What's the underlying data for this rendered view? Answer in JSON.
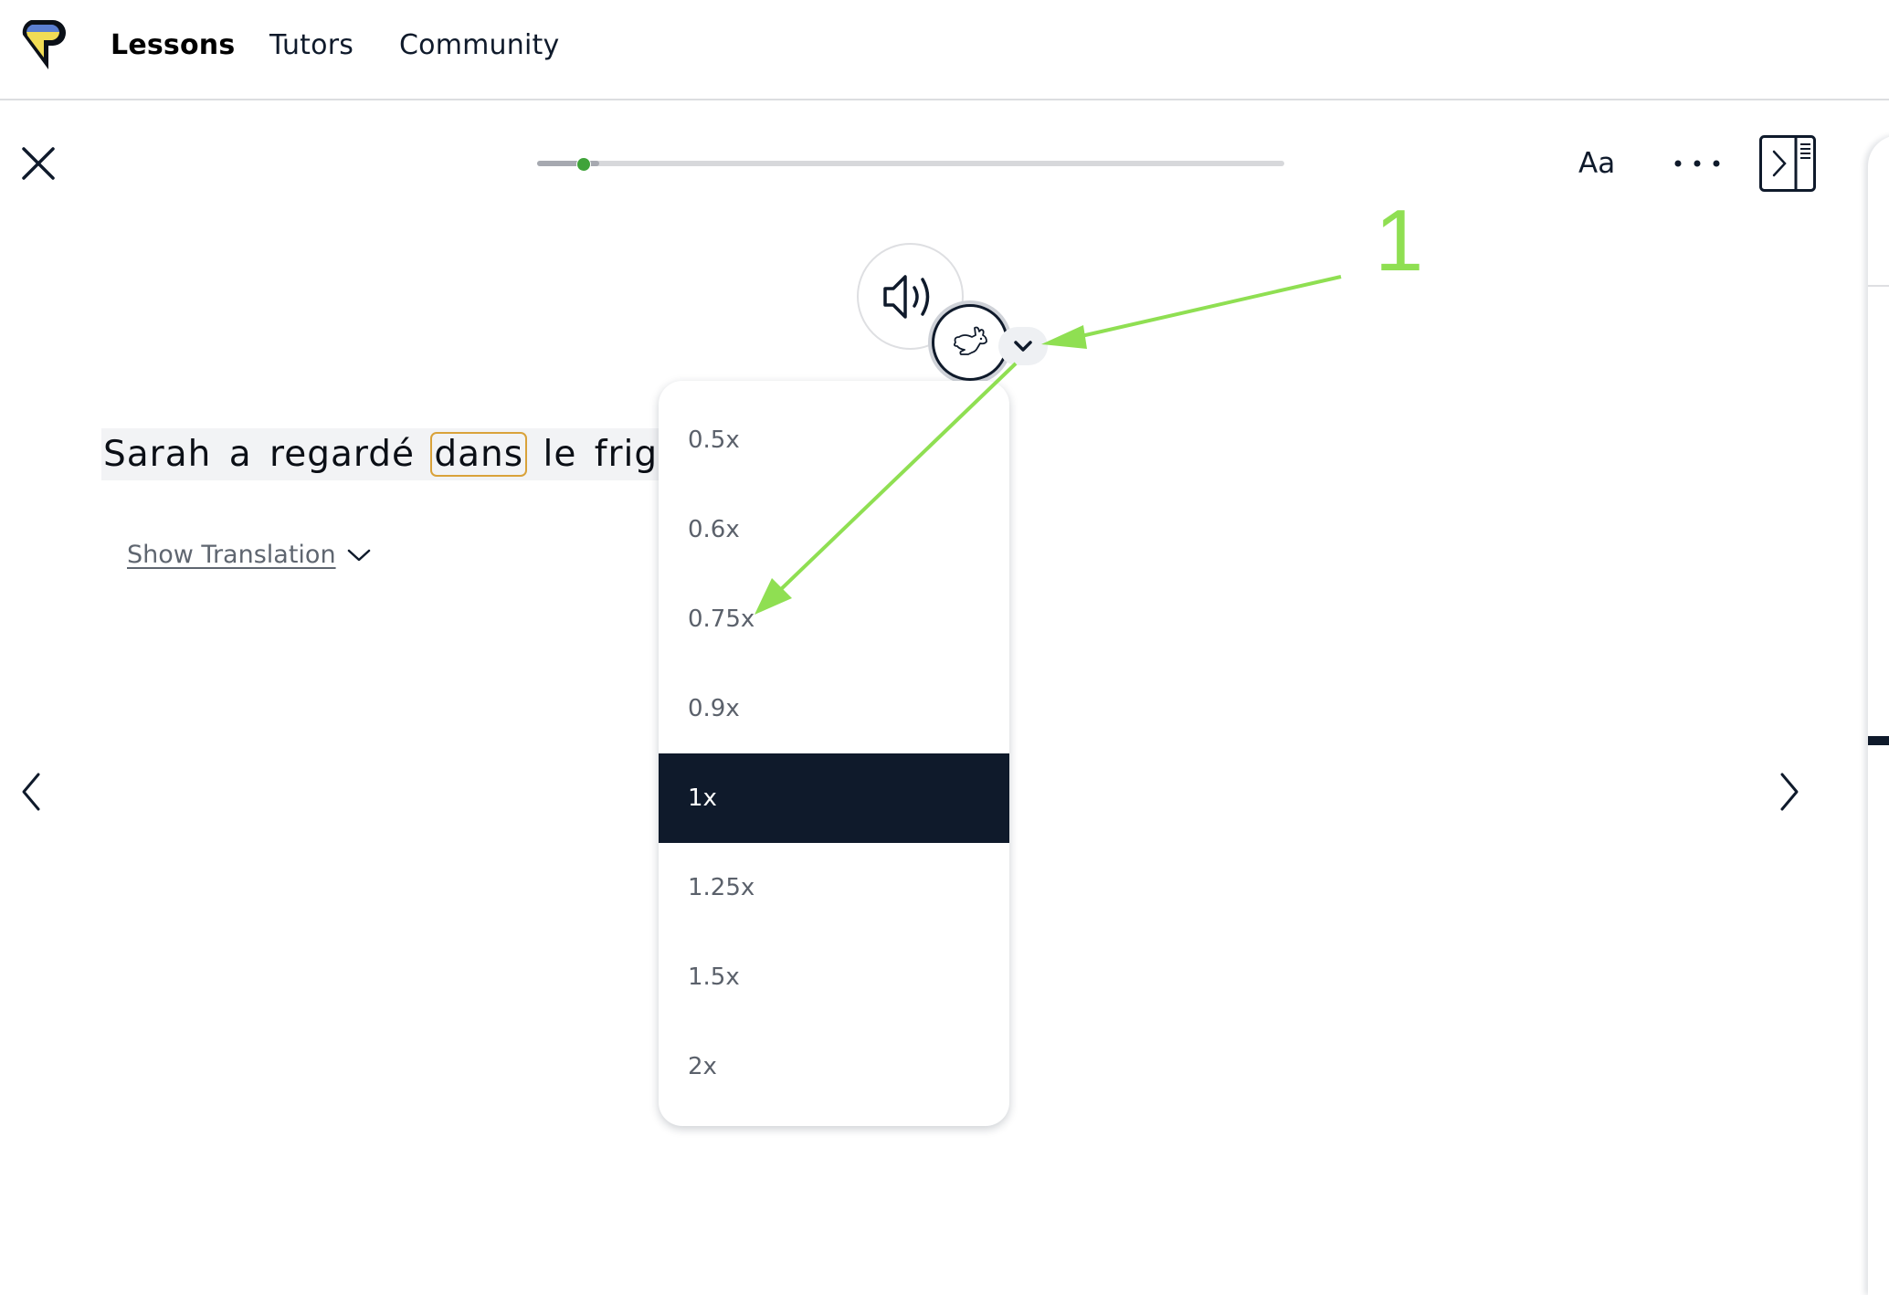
{
  "header": {
    "logo_icon": "speech-bubble-logo",
    "nav": [
      {
        "label": "Lessons",
        "active": true
      },
      {
        "label": "Tutors",
        "active": false
      },
      {
        "label": "Community",
        "active": false
      }
    ]
  },
  "toolbar": {
    "close_icon": "close-icon",
    "progress": {
      "fraction": 0.062,
      "fill_fraction": 0.083
    },
    "font_size_label": "Aa",
    "more_icon": "ellipsis-icon",
    "panel_toggle_icon": "sidebar-toggle-icon"
  },
  "audio": {
    "speaker_icon": "speaker-icon",
    "speed_icon": "rabbit-icon",
    "speed_dropdown_icon": "chevron-down-icon"
  },
  "lesson": {
    "sentence_words": [
      "Sarah",
      "a",
      "regardé",
      "dans",
      "le",
      "frigo."
    ],
    "highlighted_word_index": 3,
    "show_translation_label": "Show Translation"
  },
  "speed_menu": {
    "options": [
      "0.5x",
      "0.6x",
      "0.75x",
      "0.9x",
      "1x",
      "1.25x",
      "1.5x",
      "2x"
    ],
    "selected": "1x"
  },
  "annotation": {
    "label": "1",
    "color": "#8fdf52"
  },
  "colors": {
    "primary_dark": "#0f1a2b",
    "progress_dot": "#3fa33a",
    "highlight_border": "#d9a23a",
    "logo_blue": "#5b7fd1",
    "logo_yellow": "#f1dc55"
  }
}
